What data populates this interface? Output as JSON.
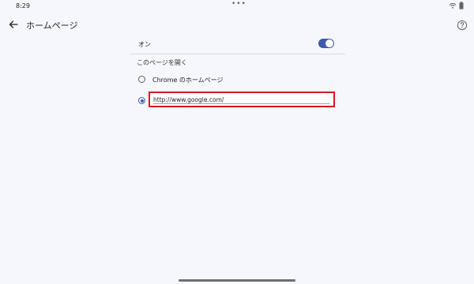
{
  "status_bar": {
    "time": "8:29",
    "dots": "•••"
  },
  "app_bar": {
    "title": "ホームページ"
  },
  "settings": {
    "on_label": "オン",
    "toggle_on": true,
    "section_title": "このページを開く",
    "options": [
      {
        "label": "Chrome のホームページ",
        "selected": false
      },
      {
        "label": "",
        "selected": true
      }
    ],
    "custom_url": {
      "value": "http://www.google.com/",
      "highlight_color": "#e0141e"
    }
  },
  "colors": {
    "accent": "#3d5ba9",
    "background": "#f6f7fc"
  }
}
